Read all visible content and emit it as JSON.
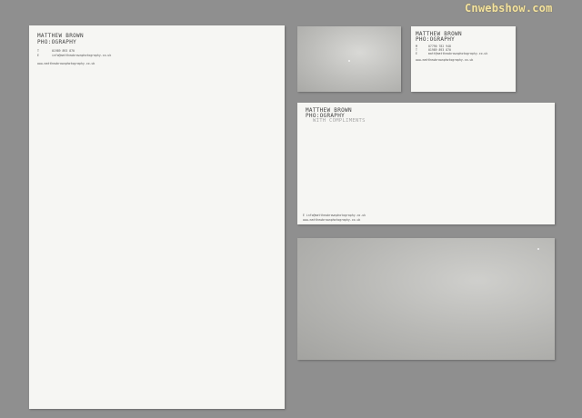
{
  "watermark": "Cnwebshow.com",
  "brand": {
    "line1": "MATTHEW BROWN",
    "line2": "PHO:OGRAPHY"
  },
  "letterhead": {
    "phone_prefix": "T",
    "phone": "01989 893 870",
    "email_prefix": "E",
    "email": "info@matthewbrownphotography.co.uk",
    "website": "www.matthewbrownphotography.co.uk"
  },
  "business_card": {
    "mobile_prefix": "M",
    "mobile": "07790 782 948",
    "phone_prefix": "T",
    "phone": "01989 893 870",
    "email_prefix": "E",
    "email": "matt@matthewbrownphotography.co.uk",
    "website": "www.matthewbrownphotography.co.uk"
  },
  "compliments_slip": {
    "tagline": "WITH COMPLIMENTS",
    "email_line": "E  info@matthewbrownphotography.co.uk",
    "website": "www.matthewbrownphotography.co.uk"
  },
  "colors": {
    "background": "#8f8f8f",
    "paper": "#f6f6f3",
    "silver": "#bdbdba",
    "watermark": "#f3e3a3"
  }
}
